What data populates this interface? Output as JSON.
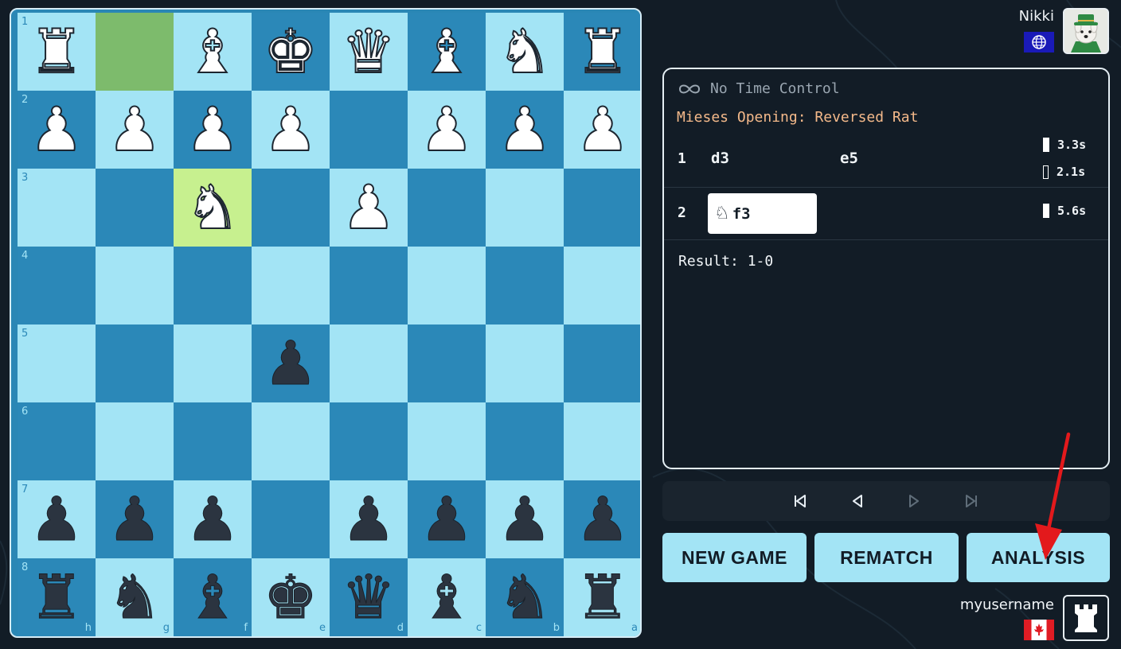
{
  "colors": {
    "background": "#121c26",
    "light_square": "#a3e4f5",
    "dark_square": "#2b88b8",
    "last_move_from": "#7dbb6c",
    "last_move_to": "#c7f08f",
    "opening_text": "#f4b98a",
    "button_bg": "#a3e4f5",
    "annotation_arrow": "#e3191c"
  },
  "board": {
    "rank_labels": [
      "1",
      "2",
      "3",
      "4",
      "5",
      "6",
      "7",
      "8"
    ],
    "file_labels": [
      "h",
      "g",
      "f",
      "e",
      "d",
      "c",
      "b",
      "a"
    ],
    "squares": [
      [
        "wR",
        "",
        "wB",
        "wK",
        "wQ",
        "wB",
        "wN",
        "wR"
      ],
      [
        "wP",
        "wP",
        "wP",
        "wP",
        "",
        "wP",
        "wP",
        "wP"
      ],
      [
        "",
        "",
        "wN",
        "",
        "wP",
        "",
        "",
        ""
      ],
      [
        "",
        "",
        "",
        "",
        "",
        "",
        "",
        ""
      ],
      [
        "",
        "",
        "",
        "bP",
        "",
        "",
        "",
        ""
      ],
      [
        "",
        "",
        "",
        "",
        "",
        "",
        "",
        ""
      ],
      [
        "bP",
        "bP",
        "bP",
        "",
        "bP",
        "bP",
        "bP",
        "bP"
      ],
      [
        "bR",
        "bN",
        "bB",
        "bK",
        "bQ",
        "bB",
        "bN",
        "bR"
      ]
    ],
    "last_move_squares": [
      "g1",
      "f3"
    ]
  },
  "opponent": {
    "name": "Nikki",
    "avatar_icon": "dog-avatar-icon",
    "flag_icon": "globe-flag-icon"
  },
  "me": {
    "name": "myusername",
    "avatar_icon": "rook-avatar-icon",
    "flag_icon": "canada-flag-icon"
  },
  "panel": {
    "time_control_icon": "infinity-icon",
    "time_control": "No Time Control",
    "opening": "Mieses Opening: Reversed Rat",
    "moves": [
      {
        "number": "1",
        "white": "d3",
        "black": "e5",
        "white_time": "3.3s",
        "black_time": "2.1s"
      },
      {
        "number": "2",
        "white_piece_icon": "knight-icon",
        "white": "f3",
        "white_time": "5.6s"
      }
    ],
    "result": "Result: 1-0"
  },
  "nav": {
    "icons": [
      "skip-back-icon",
      "step-back-icon",
      "step-forward-icon",
      "skip-forward-icon"
    ]
  },
  "buttons": {
    "new_game": "NEW GAME",
    "rematch": "REMATCH",
    "analysis": "ANALYSIS"
  }
}
